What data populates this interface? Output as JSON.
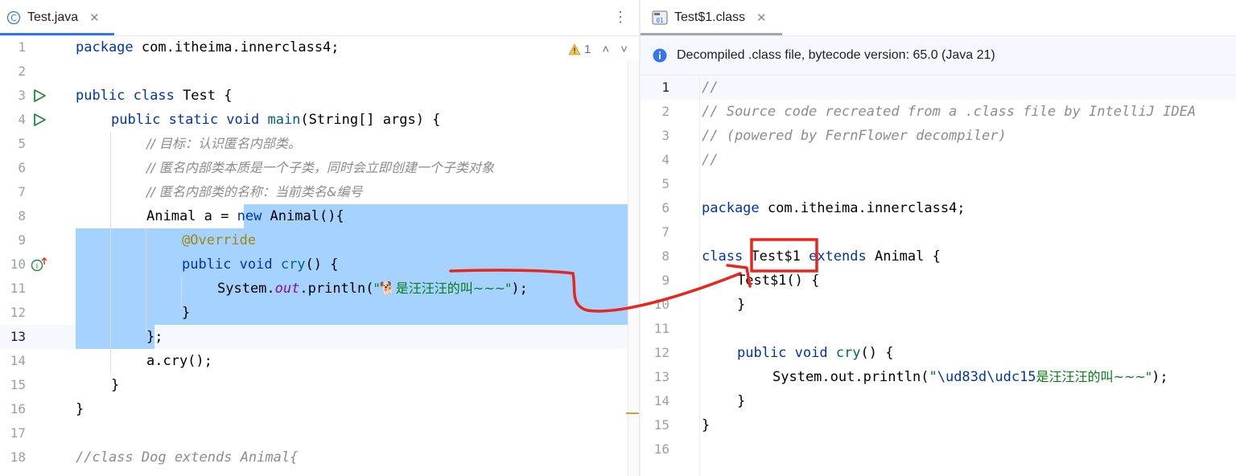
{
  "left_tab": {
    "title": "Test.java",
    "close": "✕",
    "more": "⋮"
  },
  "right_tab": {
    "title": "Test$1.class",
    "close": "✕"
  },
  "inspections": {
    "warning_count": "1",
    "up": "˄",
    "down": "˅"
  },
  "info_bar": {
    "text": "Decompiled .class file, bytecode version: 65.0 (Java 21)"
  },
  "colors": {
    "accent": "#3574f0",
    "selection": "#a6d2ff",
    "annotation_red": "#e8261c",
    "keyword": "#0033b3",
    "string": "#067d17"
  },
  "left_lines": {
    "l1a": "package",
    "l1b": " com.itheima.innerclass4;",
    "l3a": "public class",
    "l3b": " Test {",
    "l4a": "public static void",
    "l4b": " main",
    "l4c": "(String[] args) {",
    "l5": "// 目标：认识匿名内部类。",
    "l6": "// 匿名内部类本质是一个子类，同时会立即创建一个子类对象",
    "l7": "// 匿名内部类的名称：当前类名&编号",
    "l8a": "Animal a = ",
    "l8b": "new",
    "l8c": " Animal(){",
    "l9": "@Override",
    "l10a": "public void",
    "l10b": " cry",
    "l10c": "() {",
    "l11a": "System.",
    "l11b": "out",
    "l11c": ".println(",
    "l11d": "\"🐕是汪汪汪的叫~~~\"",
    "l11e": ");",
    "l12": "}",
    "l13": "};",
    "l14": "a.cry();",
    "l15": "}",
    "l16": "}",
    "l18": "//class Dog extends Animal{"
  },
  "right_lines": {
    "r1": "//",
    "r2": "// Source code recreated from a .class file by IntelliJ IDEA",
    "r3": "// (powered by FernFlower decompiler)",
    "r4": "//",
    "r6a": "package",
    "r6b": " com.itheima.innerclass4;",
    "r8a": "class",
    "r8b": " Test$1 ",
    "r8c": "extends",
    "r8d": " Animal {",
    "r9": "Test$1() {",
    "r10": "}",
    "r12a": "public void",
    "r12b": " cry",
    "r12c": "() {",
    "r13a": "System.out.println(",
    "r13b": "\"",
    "r13c": "\\ud83d\\udc15",
    "r13d": "是汪汪汪的叫~~~\"",
    "r13e": ");",
    "r14": "}",
    "r15": "}"
  }
}
